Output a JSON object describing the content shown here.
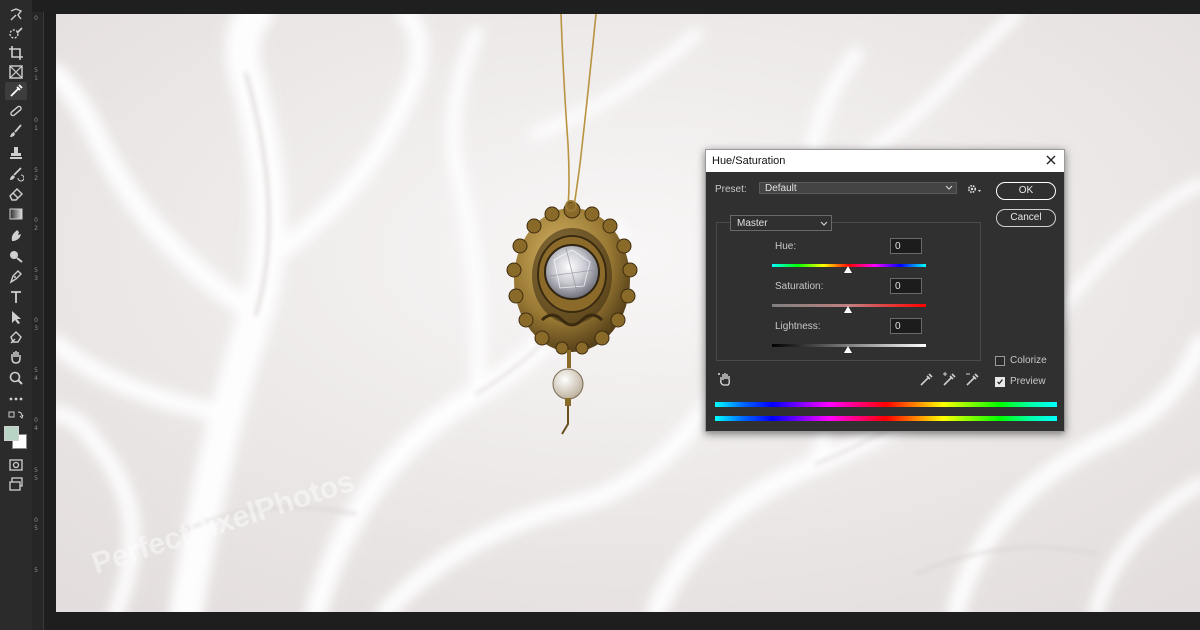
{
  "dialog": {
    "title": "Hue/Saturation",
    "preset_label": "Preset:",
    "preset_value": "Default",
    "ok_label": "OK",
    "cancel_label": "Cancel",
    "channel_value": "Master",
    "hue_label": "Hue:",
    "hue_value": "0",
    "saturation_label": "Saturation:",
    "saturation_value": "0",
    "lightness_label": "Lightness:",
    "lightness_value": "0",
    "colorize_label": "Colorize",
    "colorize_checked": false,
    "preview_label": "Preview",
    "preview_checked": true
  },
  "ruler": {
    "numbers": [
      "0",
      "5",
      "1",
      "0",
      "1",
      "5",
      "2",
      "0",
      "2",
      "5",
      "3",
      "0",
      "3",
      "5",
      "4",
      "0",
      "4",
      "5",
      "5",
      "0",
      "5",
      "5"
    ]
  },
  "colors": {
    "dialog_bg": "#303030",
    "toolbar_bg": "#2b2b2b",
    "foreground_swatch": "#b8d4c4",
    "background_swatch": "#ffffff"
  },
  "toolbar": {
    "tools": [
      "lasso-icon",
      "quick-select-icon",
      "crop-icon",
      "frame-icon",
      "eyedropper-icon",
      "healing-brush-icon",
      "brush-icon",
      "clone-stamp-icon",
      "history-brush-icon",
      "eraser-icon",
      "gradient-icon",
      "smudge-icon",
      "dodge-icon",
      "pen-icon",
      "type-icon",
      "path-select-icon",
      "shape-icon",
      "hand-icon",
      "zoom-icon",
      "more-tools-icon"
    ]
  }
}
